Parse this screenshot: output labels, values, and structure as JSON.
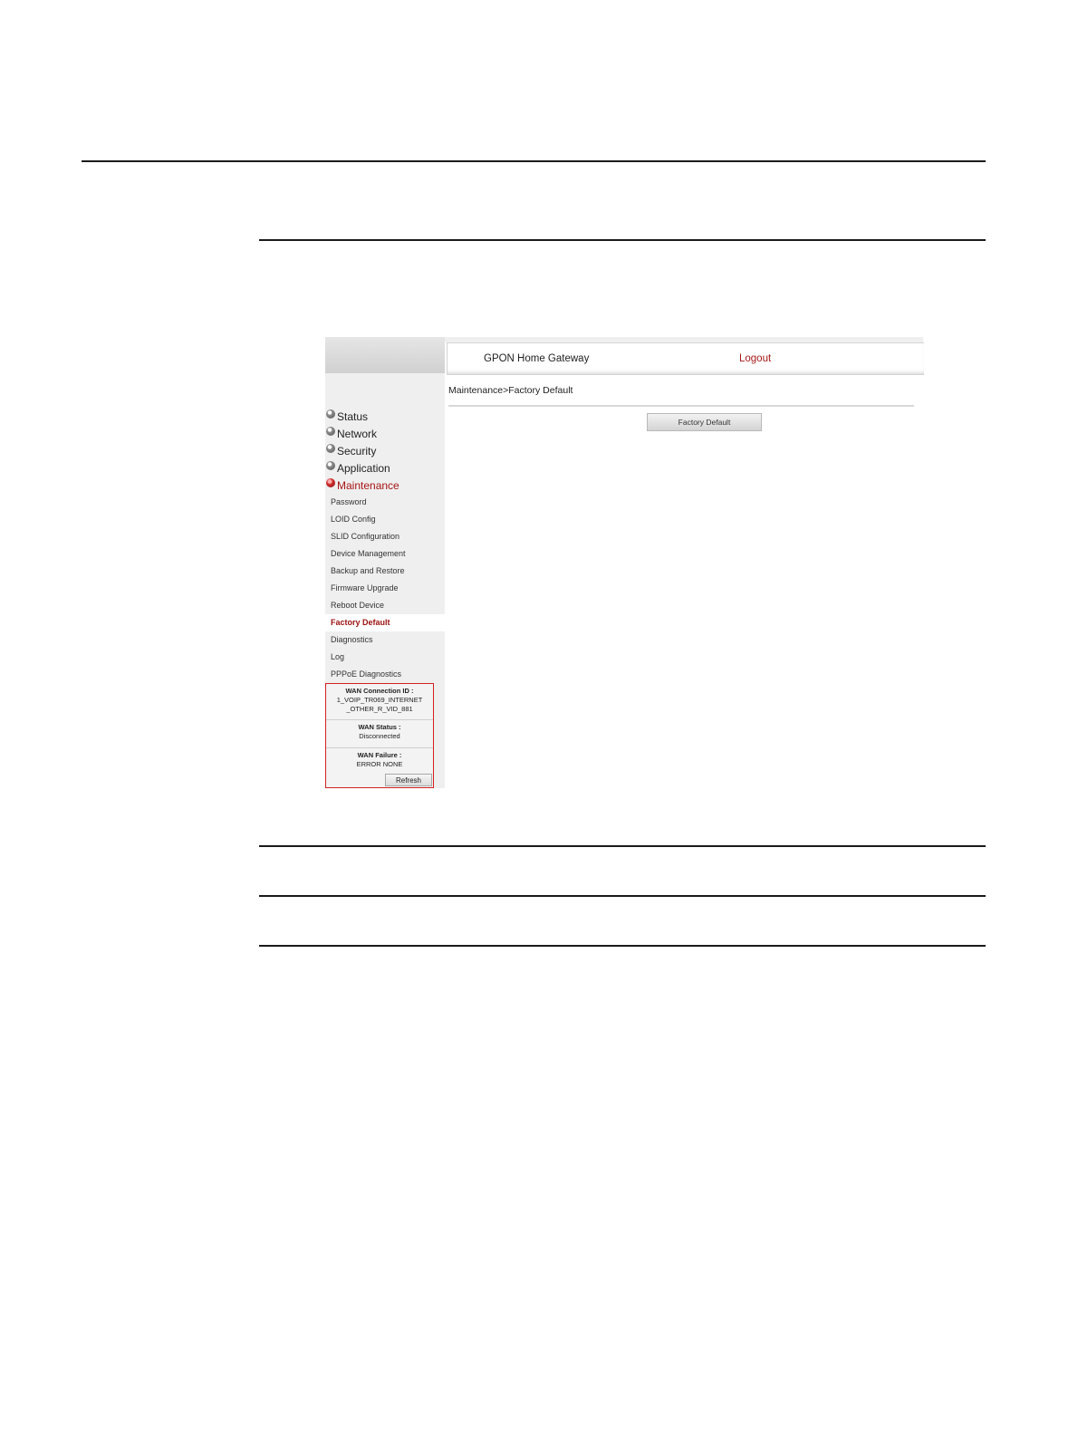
{
  "header": {
    "title": "GPON Home Gateway",
    "logout": "Logout"
  },
  "breadcrumb": "Maintenance>Factory Default",
  "menu": [
    {
      "label": "Status",
      "icon": "plus-bullet-icon",
      "expanded": false
    },
    {
      "label": "Network",
      "icon": "plus-bullet-icon",
      "expanded": false
    },
    {
      "label": "Security",
      "icon": "plus-bullet-icon",
      "expanded": false
    },
    {
      "label": "Application",
      "icon": "plus-bullet-icon",
      "expanded": false
    },
    {
      "label": "Maintenance",
      "icon": "minus-bullet-icon",
      "expanded": true
    }
  ],
  "submenu": [
    {
      "label": "Password",
      "current": false
    },
    {
      "label": "LOID Config",
      "current": false
    },
    {
      "label": "SLID Configuration",
      "current": false
    },
    {
      "label": "Device Management",
      "current": false
    },
    {
      "label": "Backup and Restore",
      "current": false
    },
    {
      "label": "Firmware Upgrade",
      "current": false
    },
    {
      "label": "Reboot Device",
      "current": false
    },
    {
      "label": "Factory Default",
      "current": true
    },
    {
      "label": "Diagnostics",
      "current": false
    },
    {
      "label": "Log",
      "current": false
    },
    {
      "label": "PPPoE Diagnostics",
      "current": false
    }
  ],
  "wan": {
    "connection_label": "WAN Connection ID :",
    "connection_value_line1": "1_VOIP_TR069_INTERNET",
    "connection_value_line2": "_OTHER_R_VID_881",
    "status_label": "WAN Status :",
    "status_value": "Disconnected",
    "failure_label": "WAN Failure :",
    "failure_value": "ERROR NONE",
    "refresh": "Refresh"
  },
  "main": {
    "factory_default_button": "Factory Default"
  },
  "colors": {
    "accent_red": "#a81a1a",
    "panel_border": "#d42020",
    "sidebar_bg": "#efefef"
  }
}
